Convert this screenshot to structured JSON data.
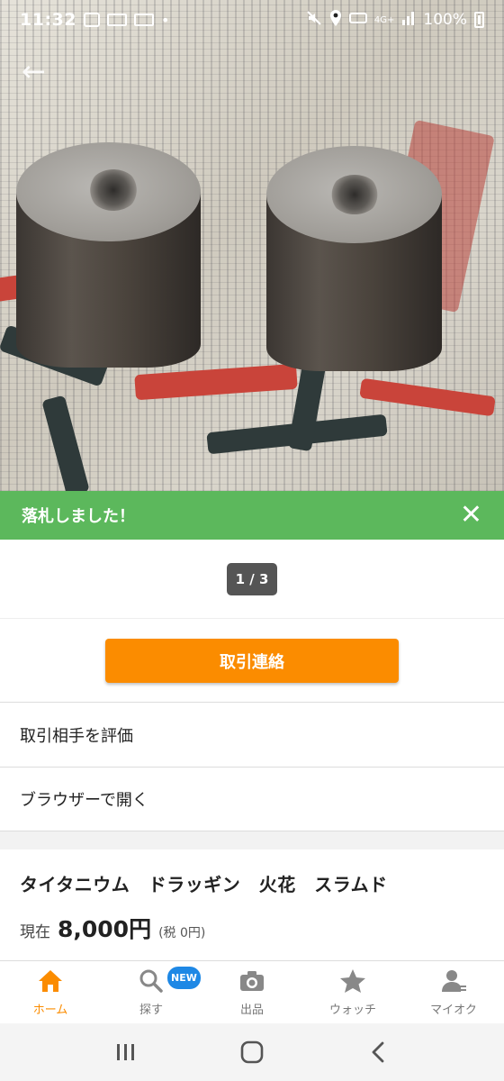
{
  "status_bar": {
    "time": "11:32",
    "network": "4G+",
    "battery": "100%"
  },
  "banner": {
    "text": "落札しました！",
    "close_icon": "close-icon"
  },
  "gallery": {
    "counter": "1 / 3"
  },
  "actions": {
    "contact_label": "取引連絡",
    "rate_label": "取引相手を評価",
    "browser_label": "ブラウザーで開く"
  },
  "item": {
    "title": "タイタニウム　ドラッギン　火花　スラムド",
    "price_label": "現在",
    "price_value": "8,000円",
    "price_tax": "(税 0円)"
  },
  "tabs": [
    {
      "label": "ホーム",
      "icon": "home-icon",
      "active": true
    },
    {
      "label": "探す",
      "icon": "search-icon",
      "badge": "NEW"
    },
    {
      "label": "出品",
      "icon": "camera-icon"
    },
    {
      "label": "ウォッチ",
      "icon": "star-icon"
    },
    {
      "label": "マイオク",
      "icon": "user-icon"
    }
  ],
  "colors": {
    "banner": "#5cb85c",
    "accent": "#fb8c00",
    "badge": "#1e88e5"
  }
}
